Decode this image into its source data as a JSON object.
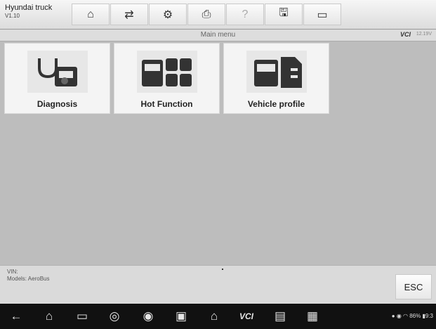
{
  "app": {
    "title": "Hyundai truck",
    "version": "V1.10"
  },
  "toolbar": [
    {
      "name": "home-button",
      "glyph": "⌂"
    },
    {
      "name": "vehicle-swap-button",
      "glyph": "⇄"
    },
    {
      "name": "settings-button",
      "glyph": "⚙"
    },
    {
      "name": "print-button",
      "glyph": "⎙"
    },
    {
      "name": "help-button",
      "glyph": "?"
    },
    {
      "name": "save-button",
      "glyph": "🖫"
    },
    {
      "name": "data-logging-button",
      "glyph": "▭"
    }
  ],
  "menubar": {
    "title": "Main menu",
    "vci": "VCI",
    "voltage": "12.19V"
  },
  "tiles": [
    {
      "label": "Diagnosis",
      "icon": "stethoscope-truck-icon"
    },
    {
      "label": "Hot Function",
      "icon": "truck-grid-icon"
    },
    {
      "label": "Vehicle profile",
      "icon": "truck-document-icon"
    }
  ],
  "bottom": {
    "vin_label": "VIN:",
    "models": "Models: AeroBus",
    "esc": "ESC"
  },
  "navbar": {
    "status": "86%"
  }
}
